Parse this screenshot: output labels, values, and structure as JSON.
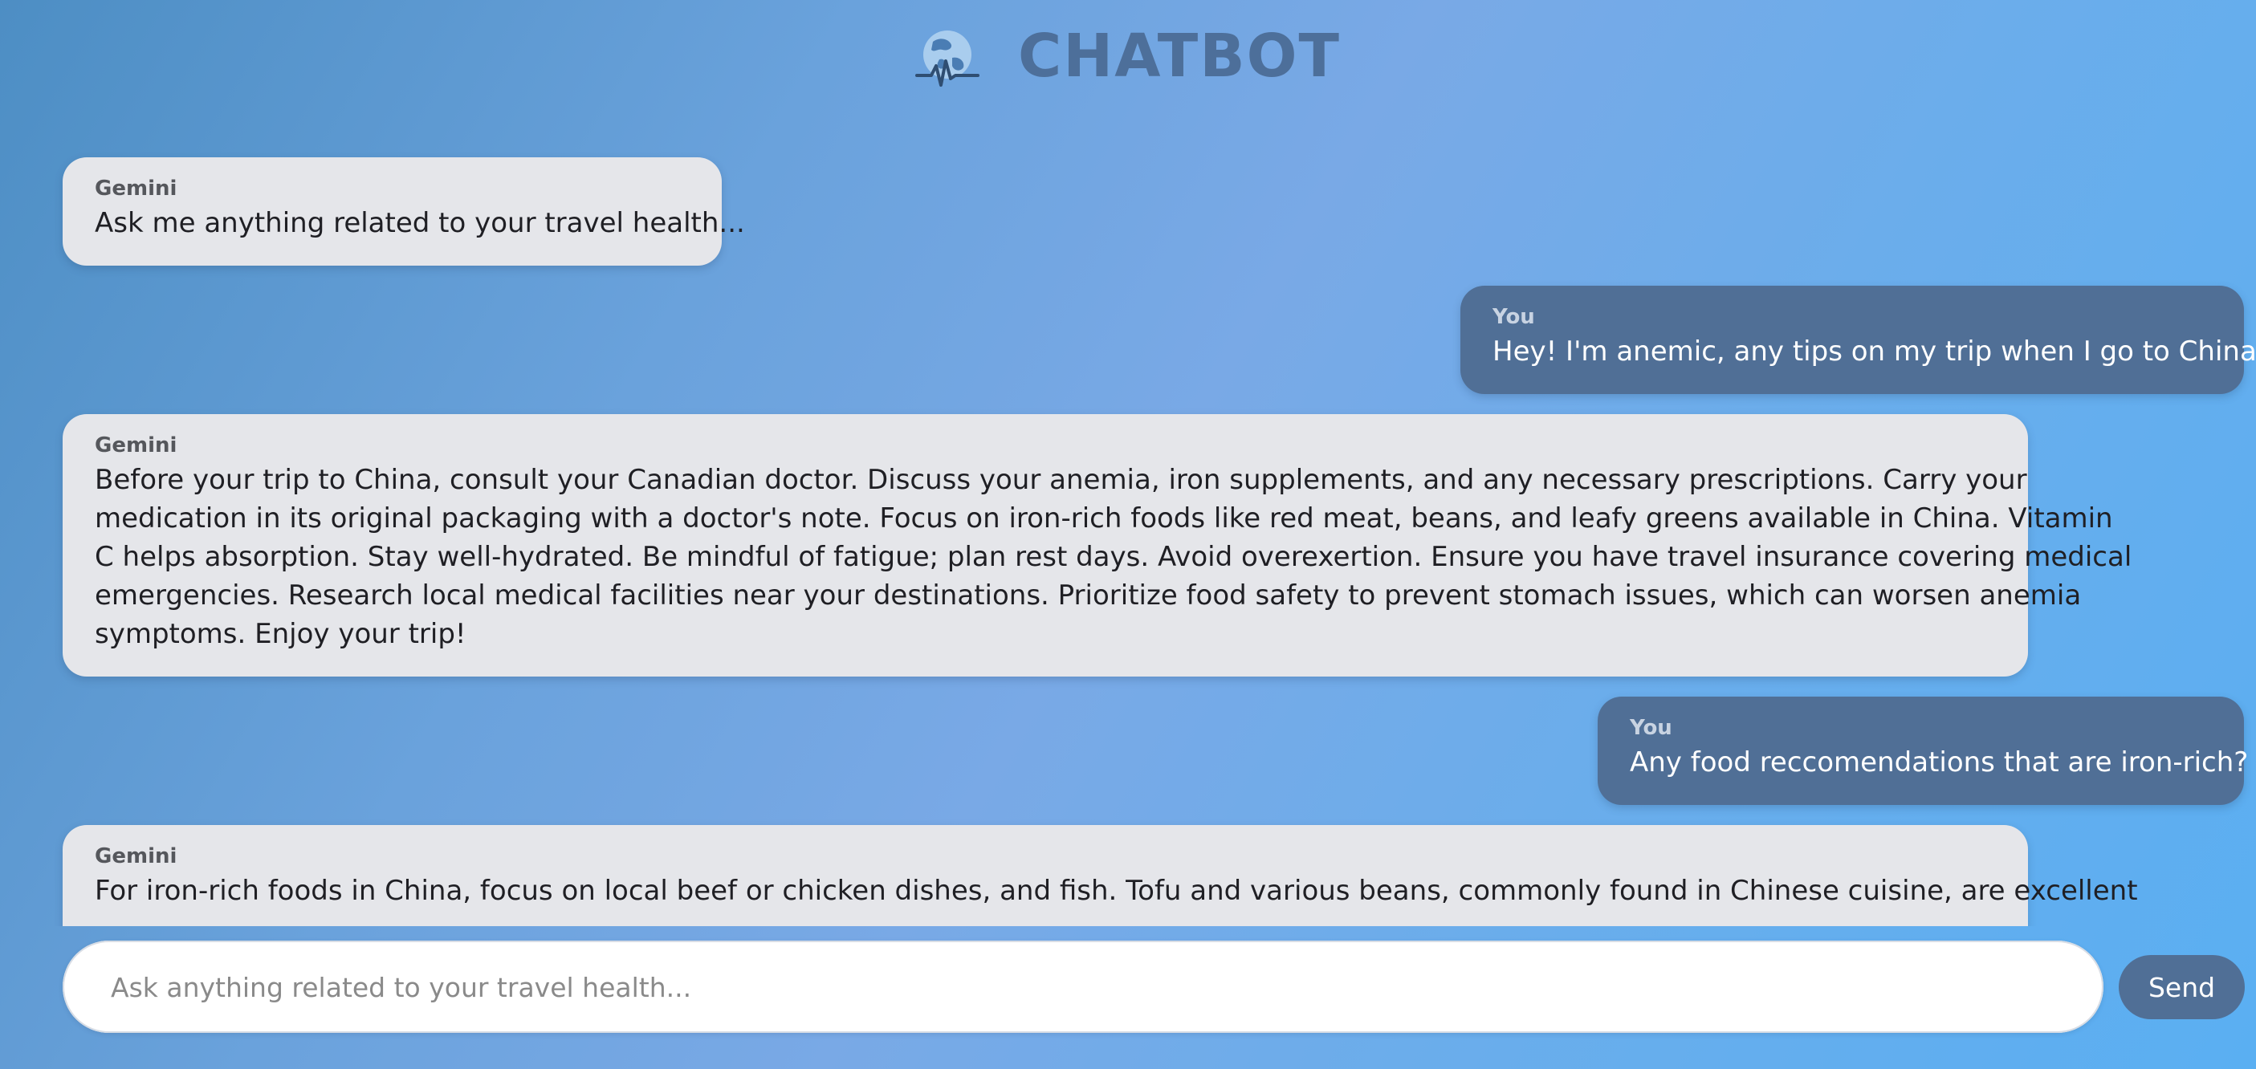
{
  "header": {
    "title": "CHATBOT",
    "logo_icon": "globe-heartbeat-icon"
  },
  "messages": [
    {
      "sender": "Gemini",
      "role": "bot",
      "text": "Ask me anything related to your travel health..."
    },
    {
      "sender": "You",
      "role": "user",
      "text": "Hey! I'm anemic, any tips on my trip when I go to China?"
    },
    {
      "sender": "Gemini",
      "role": "bot",
      "lines": [
        "Before your trip to China, consult your Canadian doctor. Discuss your anemia, iron supplements, and any necessary prescriptions. Carry your",
        "medication in its original packaging with a doctor's note. Focus on iron-rich foods like red meat, beans, and leafy greens available in China. Vitamin",
        "C helps absorption. Stay well-hydrated. Be mindful of fatigue; plan rest days. Avoid overexertion. Ensure you have travel insurance covering medical",
        "emergencies. Research local medical facilities near your destinations. Prioritize food safety to prevent stomach issues, which can worsen anemia",
        "symptoms. Enjoy your trip!"
      ]
    },
    {
      "sender": "You",
      "role": "user",
      "text": "Any food reccomendations that are iron-rich?"
    },
    {
      "sender": "Gemini",
      "role": "bot",
      "text": "For iron-rich foods in China, focus on local beef or chicken dishes, and fish. Tofu and various beans, commonly found in Chinese cuisine, are excellent"
    }
  ],
  "input": {
    "placeholder": "Ask anything related to your travel health...",
    "value": ""
  },
  "send_button": {
    "label": "Send"
  },
  "colors": {
    "bot_bubble": "#e5e6ea",
    "user_bubble": "#506f96",
    "title": "#4d6f9a",
    "send_button": "#506f96"
  }
}
